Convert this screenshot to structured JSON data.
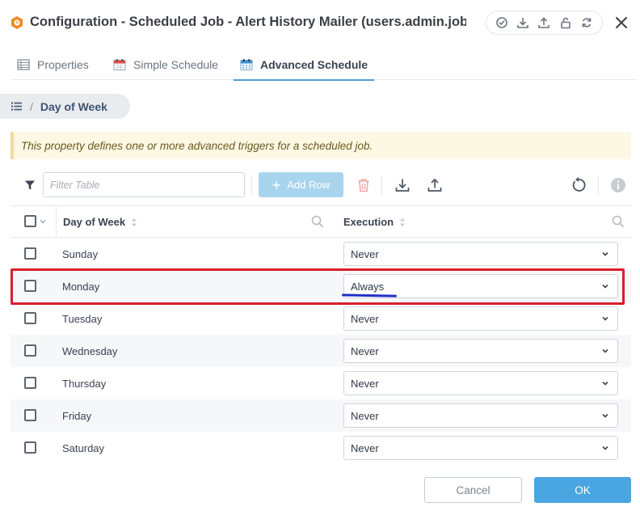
{
  "window": {
    "title": "Configuration - Scheduled Job - Alert History Mailer (users.admin.jobs.a...",
    "actions": [
      "verify-icon",
      "download-icon",
      "upload-icon",
      "unlock-icon",
      "refresh-icon"
    ],
    "close_icon": "close-icon"
  },
  "tabs": [
    {
      "label": "Properties",
      "icon": "table-icon",
      "active": false
    },
    {
      "label": "Simple Schedule",
      "icon": "calendar-icon",
      "active": false
    },
    {
      "label": "Advanced Schedule",
      "icon": "calendar-grid-icon",
      "active": true
    }
  ],
  "breadcrumb": {
    "separator": "/",
    "label": "Day of Week"
  },
  "info_message": "This property defines one or more advanced triggers for a scheduled job.",
  "toolbar": {
    "filter_placeholder": "Filter Table",
    "add_row_label": "Add Row"
  },
  "table": {
    "columns": [
      "Day of Week",
      "Execution"
    ],
    "rows": [
      {
        "day": "Sunday",
        "execution": "Never"
      },
      {
        "day": "Monday",
        "execution": "Always"
      },
      {
        "day": "Tuesday",
        "execution": "Never"
      },
      {
        "day": "Wednesday",
        "execution": "Never"
      },
      {
        "day": "Thursday",
        "execution": "Never"
      },
      {
        "day": "Friday",
        "execution": "Never"
      },
      {
        "day": "Saturday",
        "execution": "Never"
      }
    ]
  },
  "footer": {
    "cancel_label": "Cancel",
    "ok_label": "OK"
  },
  "colors": {
    "accent": "#49a6e0",
    "add_row_disabled": "#a9d4ee",
    "info_bg": "#fcf8e3",
    "highlight": "#d8202a",
    "delete_icon": "#f0a7a7"
  }
}
